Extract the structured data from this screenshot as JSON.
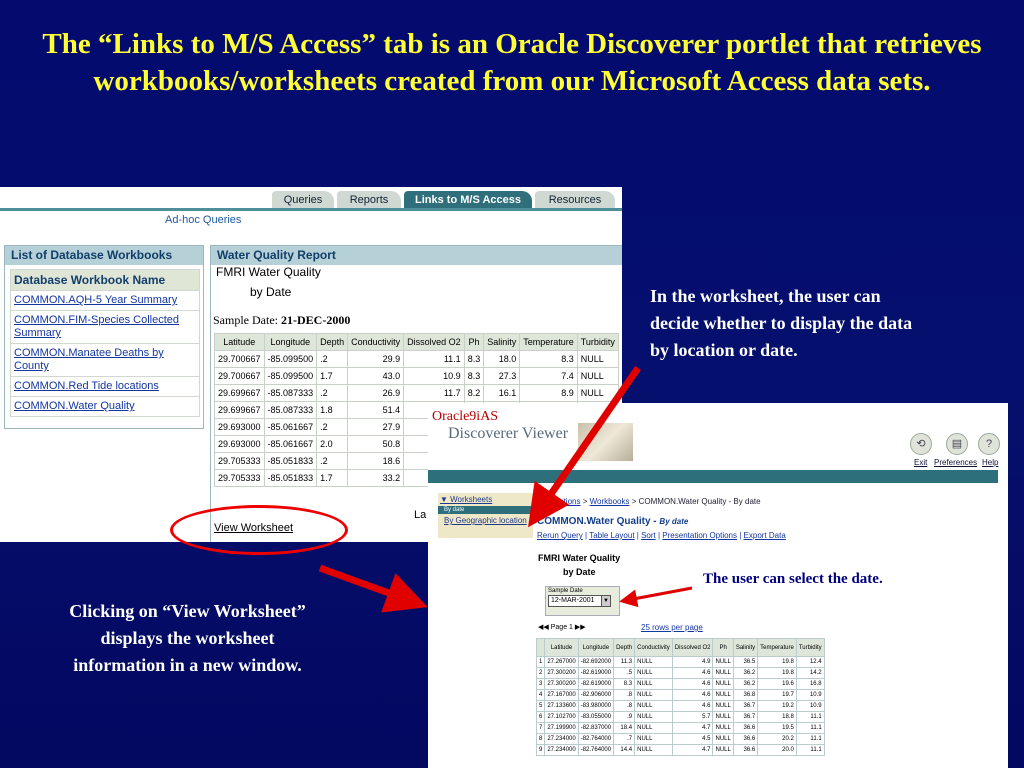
{
  "slide_title": "The “Links to M/S Access” tab is an Oracle Discoverer portlet that retrieves workbooks/worksheets created from our Microsoft Access data sets.",
  "note_worksheet": "In the worksheet, the user can decide whether to display the data by location or date.",
  "note_click": "Clicking on “View Worksheet” displays the worksheet information in a new window.",
  "note_date": "The user can select the date.",
  "portal": {
    "tabs": [
      "Queries",
      "Reports",
      "Links to M/S Access",
      "Resources"
    ],
    "adhoc_label": "Ad-hoc Queries",
    "list_header": "List of Database Workbooks",
    "list_col": "Database Workbook Name",
    "workbooks": [
      "COMMON.AQH-5 Year Summary",
      "COMMON.FIM-Species Collected Summary",
      "COMMON.Manatee Deaths by County",
      "COMMON.Red Tide locations",
      "COMMON.Water Quality"
    ],
    "report_header": "Water Quality Report",
    "report_title": "FMRI Water Quality",
    "report_subtitle": "by Date",
    "sample_date_label": "Sample Date:",
    "sample_date_value": "21-DEC-2000",
    "columns": [
      "Latitude",
      "Longitude",
      "Depth",
      "Conductivity",
      "Dissolved O2",
      "Ph",
      "Salinity",
      "Temperature",
      "Turbidity"
    ],
    "rows": [
      [
        "29.700667",
        "-85.099500",
        ".2",
        "29.9",
        "11.1",
        "8.3",
        "18.0",
        "8.3",
        "NULL"
      ],
      [
        "29.700667",
        "-85.099500",
        "1.7",
        "43.0",
        "10.9",
        "8.3",
        "27.3",
        "7.4",
        "NULL"
      ],
      [
        "29.699667",
        "-85.087333",
        ".2",
        "26.9",
        "11.7",
        "8.2",
        "16.1",
        "8.9",
        "NULL"
      ],
      [
        "29.699667",
        "-85.087333",
        "1.8",
        "51.4",
        "",
        "",
        "",
        "",
        ""
      ],
      [
        "29.693000",
        "-85.061667",
        ".2",
        "27.9",
        "",
        "",
        "",
        "",
        ""
      ],
      [
        "29.693000",
        "-85.061667",
        "2.0",
        "50.8",
        "",
        "",
        "",
        "",
        ""
      ],
      [
        "29.705333",
        "-85.051833",
        ".2",
        "18.6",
        "",
        "",
        "",
        "",
        ""
      ],
      [
        "29.705333",
        "-85.051833",
        "1.7",
        "33.2",
        "",
        "",
        "",
        "",
        ""
      ]
    ],
    "partial_text": "La",
    "view_worksheet": "View Worksheet"
  },
  "viewer": {
    "brand_line1": "Oracle9iAS",
    "brand_line2": "Discoverer Viewer",
    "icons": [
      {
        "name": "exit-icon",
        "label": "Exit",
        "glyph": "⟲"
      },
      {
        "name": "preferences-icon",
        "label": "Preferences",
        "glyph": "▤"
      },
      {
        "name": "help-icon",
        "label": "Help",
        "glyph": "?"
      }
    ],
    "side_worksheets": "Worksheets",
    "side_bydate": "By date",
    "side_geo": "By Geographic location",
    "breadcrumb": [
      "Connections",
      "Workbooks",
      "COMMON.Water Quality - By date"
    ],
    "worksheet_title": "COMMON.Water Quality -",
    "worksheet_sub": "By date",
    "links": [
      "Rerun Query",
      "Table Layout",
      "Sort",
      "Presentation Options",
      "Export Data"
    ],
    "report_title": "FMRI Water Quality",
    "report_subtitle": "by Date",
    "sample_date_label": "Sample Date",
    "sample_date_value": "12-MAR-2001",
    "page_label": "Page 1",
    "rows_per_page": "25 rows per page",
    "columns": [
      "",
      "Latitude",
      "Longitude",
      "Depth",
      "Conductivity",
      "Dissolved O2",
      "Ph",
      "Salinity",
      "Temperature",
      "Turbidity"
    ],
    "rows": [
      [
        "1",
        "27.267000",
        "-82.692000",
        "11.3",
        "NULL",
        "4.9",
        "NULL",
        "36.5",
        "19.8",
        "12.4"
      ],
      [
        "2",
        "27.300200",
        "-82.619000",
        ".5",
        "NULL",
        "4.6",
        "NULL",
        "36.2",
        "19.8",
        "14.2"
      ],
      [
        "3",
        "27.300200",
        "-82.619000",
        "8.3",
        "NULL",
        "4.6",
        "NULL",
        "36.2",
        "19.6",
        "16.8"
      ],
      [
        "4",
        "27.167000",
        "-82.906000",
        ".8",
        "NULL",
        "4.6",
        "NULL",
        "36.8",
        "19.7",
        "10.9"
      ],
      [
        "5",
        "27.133600",
        "-83.980000",
        ".8",
        "NULL",
        "4.6",
        "NULL",
        "36.7",
        "19.2",
        "10.9"
      ],
      [
        "6",
        "27.102700",
        "-83.055000",
        ".9",
        "NULL",
        "5.7",
        "NULL",
        "36.7",
        "18.8",
        "11.1"
      ],
      [
        "7",
        "27.199900",
        "-82.837000",
        "18.4",
        "NULL",
        "4.7",
        "NULL",
        "36.6",
        "19.5",
        "11.1"
      ],
      [
        "8",
        "27.234000",
        "-82.764000",
        ".7",
        "NULL",
        "4.5",
        "NULL",
        "36.6",
        "20.2",
        "11.1"
      ],
      [
        "9",
        "27.234000",
        "-82.764000",
        "14.4",
        "NULL",
        "4.7",
        "NULL",
        "36.6",
        "20.0",
        "11.1"
      ]
    ]
  },
  "colors": {
    "background": "#040a6e",
    "title": "#ffff33",
    "accent_teal": "#2e6f7c",
    "arrow": "#e00000"
  }
}
